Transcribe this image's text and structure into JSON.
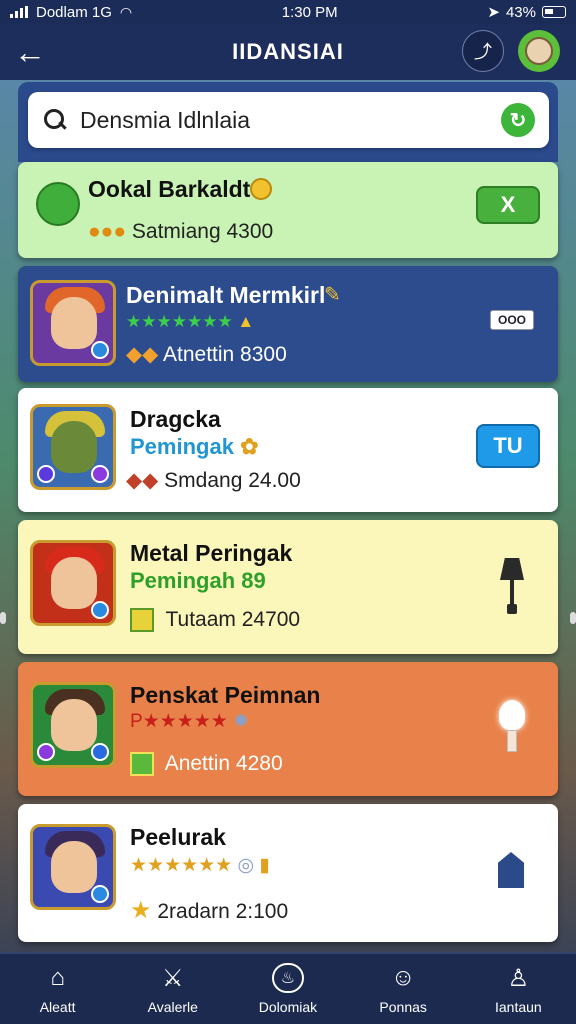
{
  "status_bar": {
    "carrier": "Dodlam 1G",
    "time": "1:30 PM",
    "battery": "43%"
  },
  "header": {
    "title": "IIDANSIAI"
  },
  "search": {
    "value": "Densmia Idlnlaia"
  },
  "cards": [
    {
      "name": "Ookal Barkaldt",
      "meta": "Satmiang 4300",
      "button": "X",
      "bg": "#c9f3b5"
    },
    {
      "name": "Denimalt Mermkirl",
      "meta": "Atnettin 8300",
      "button": "OOO",
      "bg": "#2d4c8e"
    },
    {
      "name": "Dragcka",
      "sub": "Pemingak",
      "meta": "Smdang 24.00",
      "button": "TU",
      "bg": "#ffffff"
    },
    {
      "name": "Metal Peringak",
      "sub": "Pemingah 89",
      "meta": "Tutaam 24700",
      "bg": "#fbf6b9"
    },
    {
      "name": "Penskat Peimnan",
      "meta": "Anettin 4280",
      "bg": "#e9824a"
    },
    {
      "name": "Peelurak",
      "meta": "2radarn 2:100",
      "bg": "#ffffff"
    }
  ],
  "nav": [
    {
      "label": "Aleatt",
      "icon": "home-icon"
    },
    {
      "label": "Avalerle",
      "icon": "swords-icon"
    },
    {
      "label": "Dolomiak",
      "icon": "flame-icon"
    },
    {
      "label": "Ponnas",
      "icon": "friends-icon"
    },
    {
      "label": "Iantaun",
      "icon": "profile-icon"
    }
  ]
}
